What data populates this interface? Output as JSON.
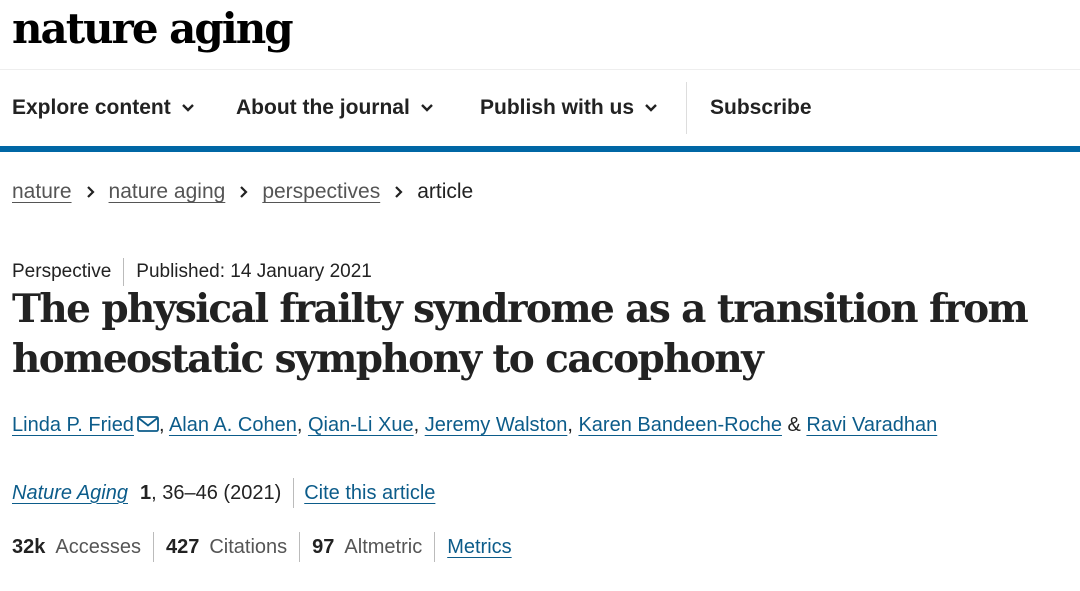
{
  "header": {
    "logo": "nature aging"
  },
  "nav": {
    "items": [
      {
        "label": "Explore content",
        "icon": "chevron-down-icon"
      },
      {
        "label": "About the journal",
        "icon": "chevron-down-icon"
      },
      {
        "label": "Publish with us",
        "icon": "chevron-down-icon"
      }
    ],
    "subscribe": "Subscribe",
    "accent_color": "#0067a5"
  },
  "breadcrumb": {
    "items": [
      "nature",
      "nature aging",
      "perspectives"
    ],
    "current": "article"
  },
  "article": {
    "type": "Perspective",
    "published": "Published: 14 January 2021",
    "title": "The physical frailty syndrome as a transition from homeostatic symphony to cacophony",
    "authors": [
      "Linda P. Fried",
      "Alan A. Cohen",
      "Qian-Li Xue",
      "Jeremy Walston",
      "Karen Bandeen-Roche",
      "Ravi Varadhan"
    ],
    "author_sep": ", ",
    "author_and": " & ",
    "journal": "Nature Aging",
    "volume": "1",
    "pages_year": ", 36–46 (2021)",
    "cite_label": "Cite this article"
  },
  "metrics": {
    "accesses_value": "32k",
    "accesses_label": "Accesses",
    "citations_value": "427",
    "citations_label": "Citations",
    "altmetric_value": "97",
    "altmetric_label": "Altmetric",
    "metrics_link": "Metrics"
  }
}
